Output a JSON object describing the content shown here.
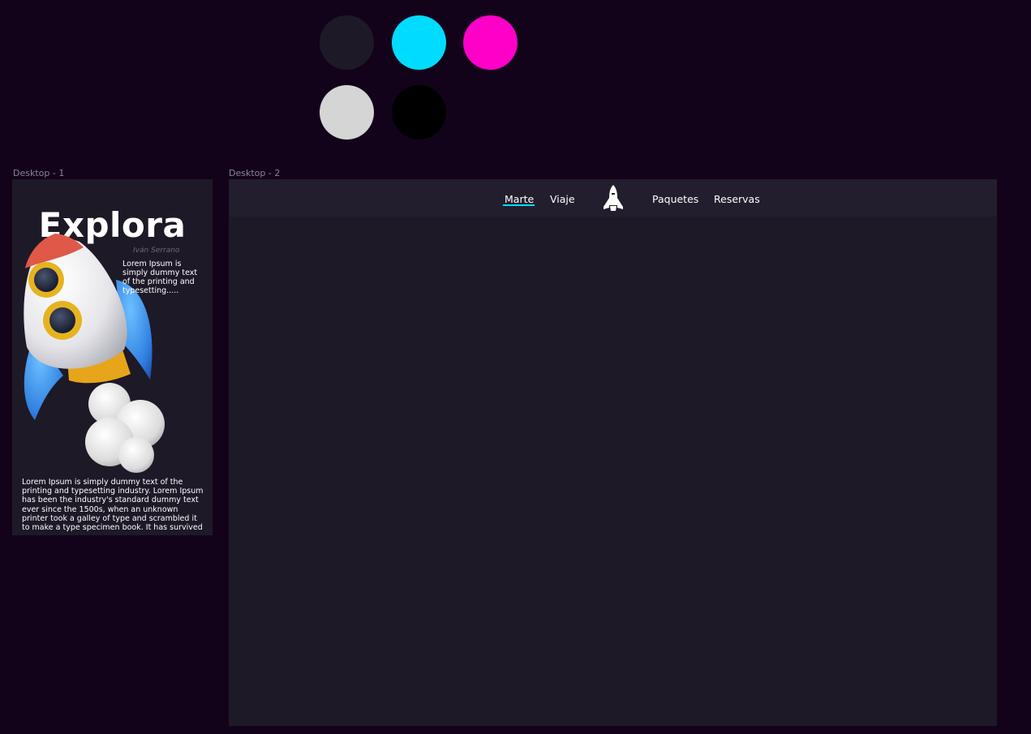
{
  "palette": {
    "colors": [
      "#1e1927",
      "#00dcff",
      "#ff00c8",
      "#d5d5d5",
      "#000000"
    ]
  },
  "frames": {
    "desktop1_label": "Desktop - 1",
    "desktop2_label": "Desktop - 2"
  },
  "desktop1": {
    "title": "Explora",
    "author": "Iván Serrano",
    "intro_text": "Lorem Ipsum is simply dummy text of the printing and typesetting.....",
    "body_text": "Lorem Ipsum is simply dummy text of the printing and typesetting industry. Lorem Ipsum has been the industry's standard dummy text ever since the 1500s, when an unknown printer took a galley of type and scrambled it to make a type specimen book. It has survived",
    "illustration": "rocket-3d-icon"
  },
  "desktop2": {
    "nav": {
      "items": [
        {
          "label": "Marte",
          "active": true
        },
        {
          "label": "Viaje"
        },
        {
          "label": "Paquetes"
        },
        {
          "label": "Reservas"
        }
      ],
      "logo_icon": "space-shuttle-icon",
      "active_underline_color": "#00dcff"
    }
  }
}
